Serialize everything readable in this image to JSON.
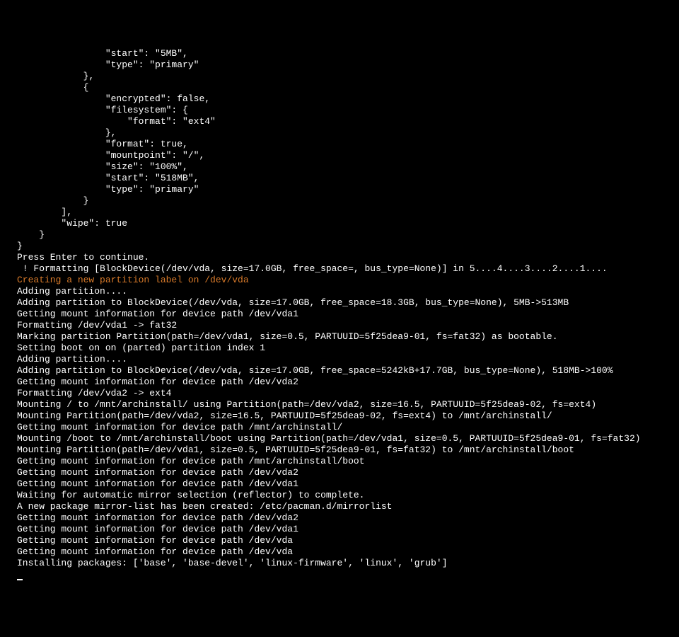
{
  "lines": [
    {
      "text": "                \"start\": \"5MB\",",
      "cls": ""
    },
    {
      "text": "                \"type\": \"primary\"",
      "cls": ""
    },
    {
      "text": "            },",
      "cls": ""
    },
    {
      "text": "            {",
      "cls": ""
    },
    {
      "text": "                \"encrypted\": false,",
      "cls": ""
    },
    {
      "text": "                \"filesystem\": {",
      "cls": ""
    },
    {
      "text": "                    \"format\": \"ext4\"",
      "cls": ""
    },
    {
      "text": "                },",
      "cls": ""
    },
    {
      "text": "                \"format\": true,",
      "cls": ""
    },
    {
      "text": "                \"mountpoint\": \"/\",",
      "cls": ""
    },
    {
      "text": "                \"size\": \"100%\",",
      "cls": ""
    },
    {
      "text": "                \"start\": \"518MB\",",
      "cls": ""
    },
    {
      "text": "                \"type\": \"primary\"",
      "cls": ""
    },
    {
      "text": "            }",
      "cls": ""
    },
    {
      "text": "        ],",
      "cls": ""
    },
    {
      "text": "        \"wipe\": true",
      "cls": ""
    },
    {
      "text": "    }",
      "cls": ""
    },
    {
      "text": "}",
      "cls": ""
    },
    {
      "text": "",
      "cls": ""
    },
    {
      "text": "Press Enter to continue.",
      "cls": ""
    },
    {
      "text": " ! Formatting [BlockDevice(/dev/vda, size=17.0GB, free_space=, bus_type=None)] in 5....4....3....2....1....",
      "cls": ""
    },
    {
      "text": "Creating a new partition label on /dev/vda",
      "cls": "orange"
    },
    {
      "text": "Adding partition....",
      "cls": ""
    },
    {
      "text": "Adding partition to BlockDevice(/dev/vda, size=17.0GB, free_space=18.3GB, bus_type=None), 5MB->513MB",
      "cls": ""
    },
    {
      "text": "Getting mount information for device path /dev/vda1",
      "cls": ""
    },
    {
      "text": "Formatting /dev/vda1 -> fat32",
      "cls": ""
    },
    {
      "text": "Marking partition Partition(path=/dev/vda1, size=0.5, PARTUUID=5f25dea9-01, fs=fat32) as bootable.",
      "cls": ""
    },
    {
      "text": "Setting boot on on (parted) partition index 1",
      "cls": ""
    },
    {
      "text": "Adding partition....",
      "cls": ""
    },
    {
      "text": "Adding partition to BlockDevice(/dev/vda, size=17.0GB, free_space=5242kB+17.7GB, bus_type=None), 518MB->100%",
      "cls": ""
    },
    {
      "text": "Getting mount information for device path /dev/vda2",
      "cls": ""
    },
    {
      "text": "Formatting /dev/vda2 -> ext4",
      "cls": ""
    },
    {
      "text": "Mounting / to /mnt/archinstall/ using Partition(path=/dev/vda2, size=16.5, PARTUUID=5f25dea9-02, fs=ext4)",
      "cls": ""
    },
    {
      "text": "Mounting Partition(path=/dev/vda2, size=16.5, PARTUUID=5f25dea9-02, fs=ext4) to /mnt/archinstall/",
      "cls": ""
    },
    {
      "text": "Getting mount information for device path /mnt/archinstall/",
      "cls": ""
    },
    {
      "text": "Mounting /boot to /mnt/archinstall/boot using Partition(path=/dev/vda1, size=0.5, PARTUUID=5f25dea9-01, fs=fat32)",
      "cls": ""
    },
    {
      "text": "Mounting Partition(path=/dev/vda1, size=0.5, PARTUUID=5f25dea9-01, fs=fat32) to /mnt/archinstall/boot",
      "cls": ""
    },
    {
      "text": "Getting mount information for device path /mnt/archinstall/boot",
      "cls": ""
    },
    {
      "text": "Getting mount information for device path /dev/vda2",
      "cls": ""
    },
    {
      "text": "Getting mount information for device path /dev/vda1",
      "cls": ""
    },
    {
      "text": "Waiting for automatic mirror selection (reflector) to complete.",
      "cls": ""
    },
    {
      "text": "A new package mirror-list has been created: /etc/pacman.d/mirrorlist",
      "cls": ""
    },
    {
      "text": "Getting mount information for device path /dev/vda2",
      "cls": ""
    },
    {
      "text": "Getting mount information for device path /dev/vda1",
      "cls": ""
    },
    {
      "text": "Getting mount information for device path /dev/vda",
      "cls": ""
    },
    {
      "text": "Getting mount information for device path /dev/vda",
      "cls": ""
    },
    {
      "text": "Installing packages: ['base', 'base-devel', 'linux-firmware', 'linux', 'grub']",
      "cls": ""
    }
  ]
}
